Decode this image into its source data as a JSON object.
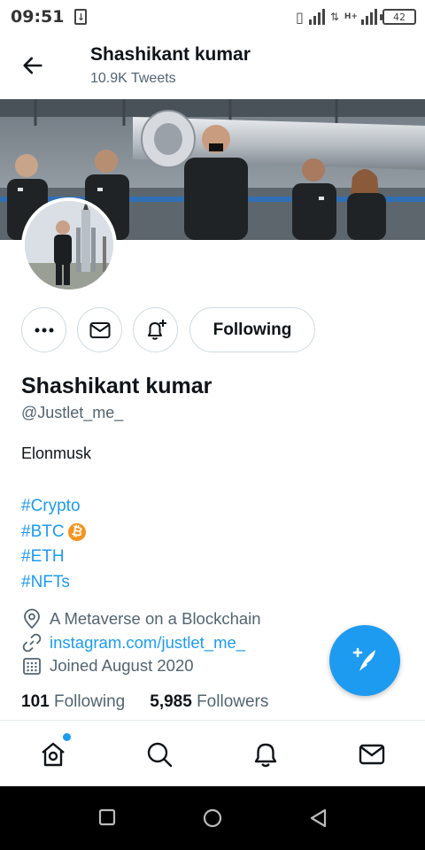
{
  "status_bar": {
    "time": "09:51",
    "battery": "42"
  },
  "header": {
    "title": "Shashikant kumar",
    "subtitle": "10.9K Tweets"
  },
  "profile": {
    "name": "Shashikant kumar",
    "handle": "@Justlet_me_",
    "bio": "Elonmusk",
    "hashtags": [
      "#Crypto",
      "#BTC",
      "#ETH",
      "#NFTs"
    ],
    "location": "A Metaverse on a Blockchain",
    "website": "instagram.com/justlet_me_",
    "joined": "Joined August 2020",
    "following_count": "101",
    "following_label": "Following",
    "followers_count": "5,985",
    "followers_label": "Followers"
  },
  "actions": {
    "follow_state_label": "Following"
  },
  "colors": {
    "accent": "#1d9bf0",
    "bitcoin": "#f7931a"
  },
  "icons": {
    "header": "back-arrow-icon",
    "actions": [
      "more-icon",
      "message-icon",
      "notification-bell-plus-icon"
    ],
    "meta": [
      "location-pin-icon",
      "link-icon",
      "calendar-icon"
    ],
    "tabs": [
      "home-icon",
      "search-icon",
      "notifications-icon",
      "messages-icon"
    ],
    "fab": "compose-tweet-icon",
    "android_nav": [
      "recents-square-icon",
      "home-circle-icon",
      "back-triangle-icon"
    ]
  }
}
